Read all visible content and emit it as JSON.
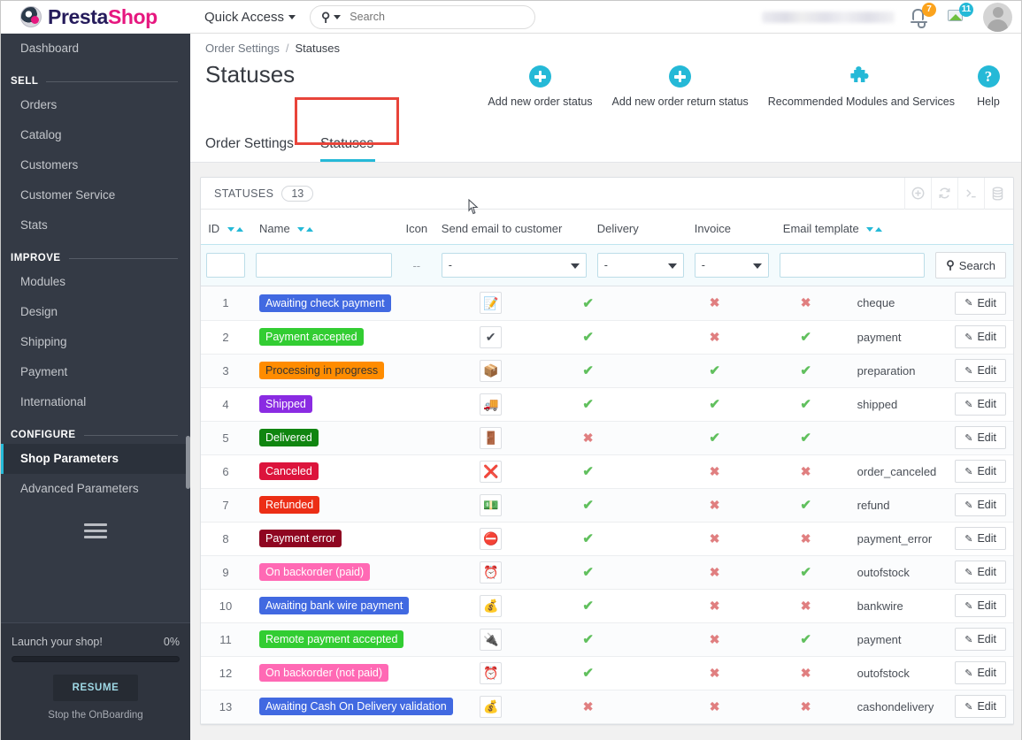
{
  "brand": {
    "name_part1": "Presta",
    "name_part2": "Shop",
    "logo_icon": "prestashop-logo-icon"
  },
  "header": {
    "quick_access": "Quick Access",
    "search_placeholder": "Search",
    "search_value": "",
    "search_icon": "search-icon",
    "notifications": {
      "bell_icon": "bell-icon",
      "bell_count": "7",
      "orders_icon": "image-icon",
      "orders_count": "11"
    },
    "avatar_icon": "user-avatar-icon",
    "badge_orange": "#fba31d",
    "badge_blue": "#25b9d7"
  },
  "sidebar": {
    "dashboard": "Dashboard",
    "sections": [
      {
        "title": "SELL",
        "items": [
          "Orders",
          "Catalog",
          "Customers",
          "Customer Service",
          "Stats"
        ]
      },
      {
        "title": "IMPROVE",
        "items": [
          "Modules",
          "Design",
          "Shipping",
          "Payment",
          "International"
        ]
      },
      {
        "title": "CONFIGURE",
        "items": [
          "Shop Parameters",
          "Advanced Parameters"
        ]
      }
    ],
    "active_item": "Shop Parameters",
    "menu_icon": "hamburger-menu-icon",
    "onboarding": {
      "title": "Launch your shop!",
      "percent": "0%",
      "progress_value": 0,
      "resume_label": "RESUME",
      "stop_label": "Stop the OnBoarding"
    }
  },
  "breadcrumb": {
    "parent": "Order Settings",
    "separator": "/",
    "current": "Statuses"
  },
  "page": {
    "title": "Statuses"
  },
  "toolbar": [
    {
      "label": "Add new order status",
      "icon": "circle-plus-icon"
    },
    {
      "label": "Add new order return status",
      "icon": "circle-plus-icon"
    },
    {
      "label": "Recommended Modules and Services",
      "icon": "puzzle-piece-icon"
    },
    {
      "label": "Help",
      "icon": "help-circle-icon"
    }
  ],
  "tabs": [
    {
      "label": "Order Settings",
      "active": false
    },
    {
      "label": "Statuses",
      "active": true,
      "highlighted": true
    }
  ],
  "panel": {
    "title": "STATUSES",
    "count": "13",
    "actions": [
      {
        "icon": "add-circle-icon"
      },
      {
        "icon": "refresh-icon"
      },
      {
        "icon": "terminal-icon"
      },
      {
        "icon": "database-icon"
      }
    ]
  },
  "table": {
    "columns": [
      {
        "key": "id",
        "label": "ID",
        "sortable": true
      },
      {
        "key": "name",
        "label": "Name",
        "sortable": true
      },
      {
        "key": "icon",
        "label": "Icon",
        "sortable": false
      },
      {
        "key": "send_email",
        "label": "Send email to customer",
        "sortable": false
      },
      {
        "key": "delivery",
        "label": "Delivery",
        "sortable": false
      },
      {
        "key": "invoice",
        "label": "Invoice",
        "sortable": false
      },
      {
        "key": "email_template",
        "label": "Email template",
        "sortable": true
      },
      {
        "key": "actions",
        "label": "",
        "sortable": false
      }
    ],
    "filters": {
      "id_value": "",
      "name_value": "",
      "icon_placeholder": "--",
      "send_email_value": "-",
      "delivery_value": "-",
      "invoice_value": "-",
      "email_template_value": "",
      "search_label": "Search",
      "search_icon": "search-icon"
    },
    "edit_label": "Edit",
    "edit_icon": "pencil-icon",
    "check_glyph": "✔",
    "cross_glyph": "✖",
    "rows": [
      {
        "id": "1",
        "name": "Awaiting check payment",
        "color": "#4169e1",
        "text_color": "#ffffff",
        "icon": "note-edit-icon",
        "icon_glyph": "📝",
        "send_email": true,
        "delivery": false,
        "invoice": false,
        "email_template": "cheque"
      },
      {
        "id": "2",
        "name": "Payment accepted",
        "color": "#32cd32",
        "text_color": "#ffffff",
        "icon": "green-check-icon",
        "icon_glyph": "✔",
        "send_email": true,
        "delivery": false,
        "invoice": true,
        "email_template": "payment"
      },
      {
        "id": "3",
        "name": "Processing in progress",
        "color": "#ff8c00",
        "text_color": "#333333",
        "icon": "package-box-icon",
        "icon_glyph": "📦",
        "send_email": true,
        "delivery": true,
        "invoice": true,
        "email_template": "preparation"
      },
      {
        "id": "4",
        "name": "Shipped",
        "color": "#8a2be2",
        "text_color": "#ffffff",
        "icon": "truck-delivery-icon",
        "icon_glyph": "🚚",
        "send_email": true,
        "delivery": true,
        "invoice": true,
        "email_template": "shipped"
      },
      {
        "id": "5",
        "name": "Delivered",
        "color": "#108510",
        "text_color": "#ffffff",
        "icon": "door-icon",
        "icon_glyph": "🚪",
        "send_email": false,
        "delivery": true,
        "invoice": true,
        "email_template": ""
      },
      {
        "id": "6",
        "name": "Canceled",
        "color": "#dc143c",
        "text_color": "#ffffff",
        "icon": "red-cross-icon",
        "icon_glyph": "❌",
        "send_email": true,
        "delivery": false,
        "invoice": false,
        "email_template": "order_canceled"
      },
      {
        "id": "7",
        "name": "Refunded",
        "color": "#ec2e15",
        "text_color": "#ffffff",
        "icon": "money-bills-icon",
        "icon_glyph": "💵",
        "send_email": true,
        "delivery": false,
        "invoice": true,
        "email_template": "refund"
      },
      {
        "id": "8",
        "name": "Payment error",
        "color": "#8f0621",
        "text_color": "#ffffff",
        "icon": "error-octagon-icon",
        "icon_glyph": "⛔",
        "send_email": true,
        "delivery": false,
        "invoice": false,
        "email_template": "payment_error"
      },
      {
        "id": "9",
        "name": "On backorder (paid)",
        "color": "#ff69b4",
        "text_color": "#ffffff",
        "icon": "alarm-clock-icon",
        "icon_glyph": "⏰",
        "send_email": true,
        "delivery": false,
        "invoice": true,
        "email_template": "outofstock"
      },
      {
        "id": "10",
        "name": "Awaiting bank wire payment",
        "color": "#4169e1",
        "text_color": "#ffffff",
        "icon": "gold-coins-icon",
        "icon_glyph": "💰",
        "send_email": true,
        "delivery": false,
        "invoice": false,
        "email_template": "bankwire"
      },
      {
        "id": "11",
        "name": "Remote payment accepted",
        "color": "#32cd32",
        "text_color": "#ffffff",
        "icon": "plug-connector-icon",
        "icon_glyph": "🔌",
        "send_email": true,
        "delivery": false,
        "invoice": true,
        "email_template": "payment"
      },
      {
        "id": "12",
        "name": "On backorder (not paid)",
        "color": "#ff69b4",
        "text_color": "#ffffff",
        "icon": "alarm-clock-icon",
        "icon_glyph": "⏰",
        "send_email": true,
        "delivery": false,
        "invoice": false,
        "email_template": "outofstock"
      },
      {
        "id": "13",
        "name": "Awaiting Cash On Delivery validation",
        "color": "#4169e1",
        "text_color": "#ffffff",
        "icon": "gold-coins-icon",
        "icon_glyph": "💰",
        "send_email": false,
        "delivery": false,
        "invoice": false,
        "email_template": "cashondelivery"
      }
    ]
  },
  "highlight_color": "#e8443a",
  "accent_color": "#25b9d7"
}
